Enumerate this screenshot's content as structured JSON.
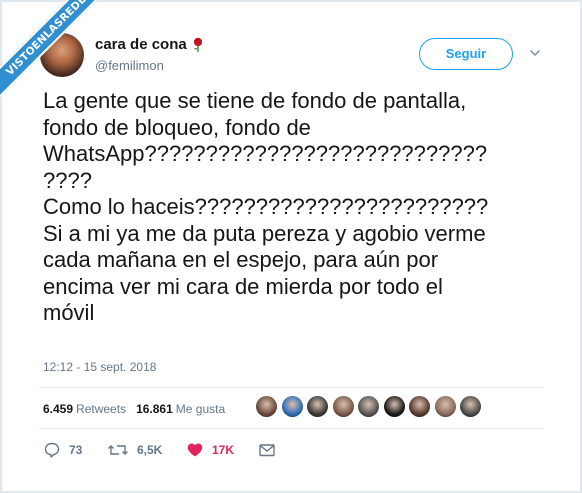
{
  "watermark": "VISTOENLASREDES",
  "user": {
    "display_name": "cara de cona",
    "handle": "@femilimon",
    "name_emoji": "rose-icon"
  },
  "follow_button": "Seguir",
  "tweet": {
    "lines": [
      "La gente que se tiene de fondo de pantalla,",
      "fondo de bloqueo, fondo de",
      "WhatsApp????????????????????????????",
      "????",
      "Como lo haceis????????????????????????",
      "Si a mi ya me da puta pereza y agobio verme",
      "cada mañana en el espejo, para aún por",
      "encima ver mi cara de mierda por todo el",
      "móvil"
    ]
  },
  "timestamp": "12:12 - 15 sept. 2018",
  "stats": {
    "retweets_count": "6.459",
    "retweets_label": "Retweets",
    "likes_count": "16.861",
    "likes_label": "Me gusta"
  },
  "liker_avatars": [
    "#6b4a3c",
    "#2f6db5",
    "#3a3a3a",
    "#7a5a48",
    "#555555",
    "#1a1a1a",
    "#5a3b30",
    "#8a6a5a",
    "#4a4a4a"
  ],
  "actions": {
    "replies": "73",
    "retweets": "6,5K",
    "likes": "17K"
  },
  "colors": {
    "accent": "#1da1f2",
    "like_red": "#e0245e",
    "muted": "#657786",
    "watermark_blue": "#2f8fd0"
  }
}
